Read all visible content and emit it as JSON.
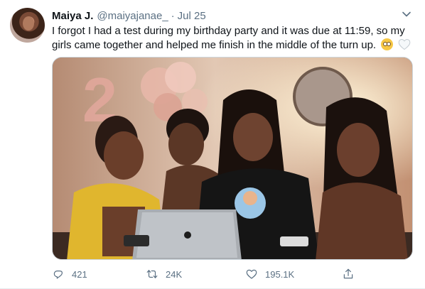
{
  "author": {
    "display_name": "Maiya J.",
    "handle": "@maiyajanae_",
    "date": "Jul 25"
  },
  "separator": "·",
  "tweet": {
    "text": "I forgot I had a test during my birthday party and it was due at 11:59, so my girls came together and helped me finish in the middle of the turn up.",
    "emojis": [
      "face-with-rolling-eyes",
      "white-heart"
    ]
  },
  "media": {
    "balloon_text": "2"
  },
  "actions": {
    "replies": "421",
    "retweets": "24K",
    "likes": "195.1K"
  },
  "colors": {
    "text": "#0f1419",
    "muted": "#5b7083",
    "border": "#ccd6dd"
  }
}
